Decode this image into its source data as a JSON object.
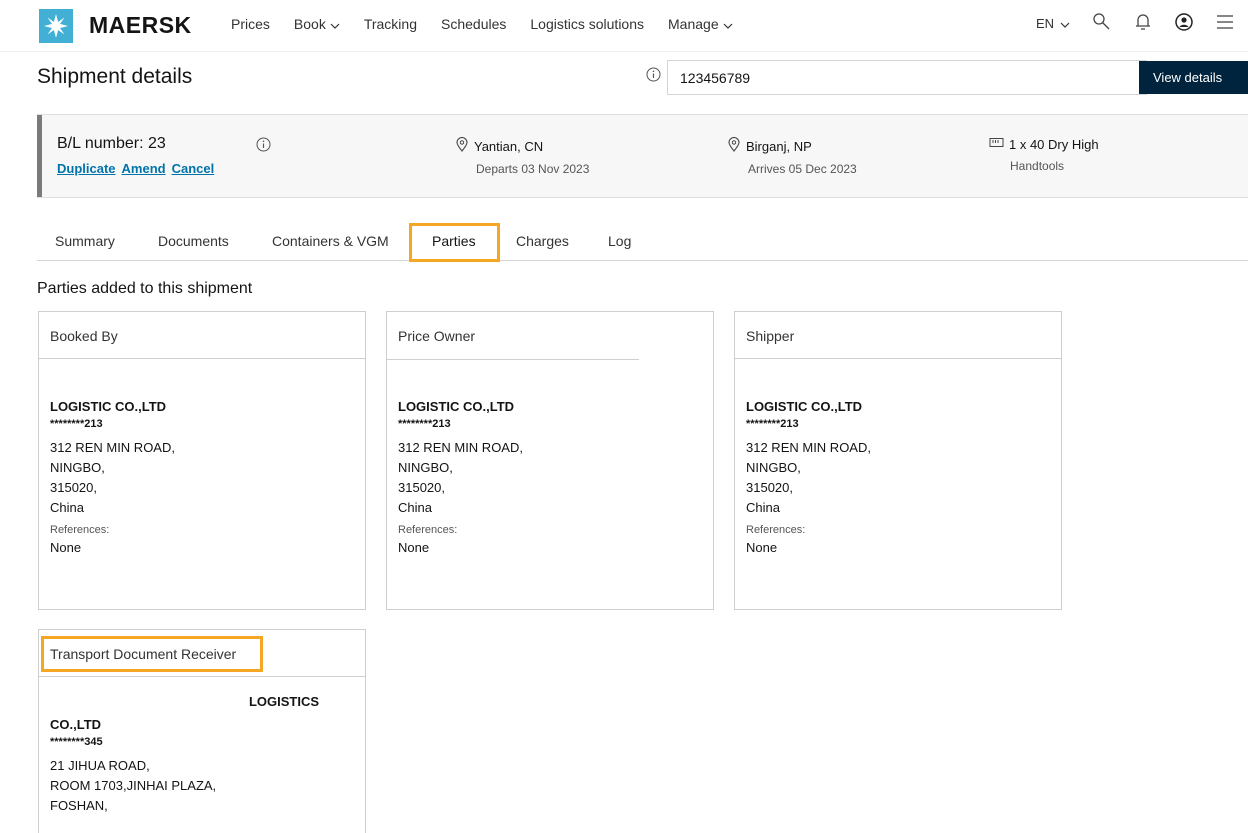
{
  "nav": {
    "brand": "MAERSK",
    "items": [
      "Prices",
      "Book",
      "Tracking",
      "Schedules",
      "Logistics solutions",
      "Manage"
    ],
    "lang": "EN",
    "icons": [
      "search-icon",
      "bell-icon",
      "user-icon",
      "menu-icon"
    ]
  },
  "header": {
    "title": "Shipment details",
    "search_value": "123456789",
    "view_button": "View details"
  },
  "banner": {
    "bl_number": "B/L number: 23",
    "links": [
      "Duplicate",
      "Amend",
      "Cancel"
    ],
    "origin": "Yantian, CN",
    "origin_date": "Departs 03 Nov 2023",
    "destination": "Birganj, NP",
    "destination_date": "Arrives 05 Dec 2023",
    "container": "1 x 40 Dry High",
    "commodity": "Handtools"
  },
  "tabs": [
    "Summary",
    "Documents",
    "Containers & VGM",
    "Parties",
    "Charges",
    "Log"
  ],
  "active_tab": "Parties",
  "section_title": "Parties added to this shipment",
  "parties": [
    {
      "role": "Booked By",
      "company": "LOGISTIC CO.,LTD",
      "masked_id": "********213",
      "address": [
        "312 REN MIN ROAD,",
        "NINGBO,",
        "315020,",
        "China"
      ],
      "references_label": "References:",
      "references": "None"
    },
    {
      "role": "Price Owner",
      "company": "LOGISTIC CO.,LTD",
      "masked_id": "********213",
      "address": [
        "312 REN MIN ROAD,",
        "NINGBO,",
        "315020,",
        "China"
      ],
      "references_label": "References:",
      "references": "None"
    },
    {
      "role": "Shipper",
      "company": "LOGISTIC CO.,LTD",
      "masked_id": "********213",
      "address": [
        "312 REN MIN ROAD,",
        "NINGBO,",
        "315020,",
        "China"
      ],
      "references_label": "References:",
      "references": "None"
    },
    {
      "role": "Transport Document Receiver",
      "company_line1": "LOGISTICS",
      "company_line2": "CO.,LTD",
      "masked_id": "********345",
      "address": [
        "21 JIHUA ROAD,",
        "ROOM 1703,JINHAI PLAZA,",
        "FOSHAN,"
      ]
    }
  ],
  "colors": {
    "accent_blue": "#42b0d5",
    "dark_navy": "#00243d",
    "link_blue": "#0073ab",
    "highlight_orange": "#f5a623"
  }
}
